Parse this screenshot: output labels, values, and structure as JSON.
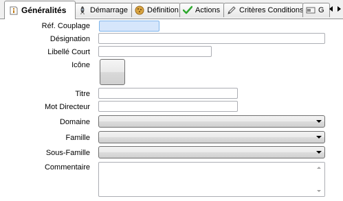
{
  "tabs": [
    {
      "label": "Généralités",
      "icon": "info-icon",
      "active": true
    },
    {
      "label": "Démarrage",
      "icon": "rocket-icon",
      "active": false
    },
    {
      "label": "Définition",
      "icon": "cookie-icon",
      "active": false
    },
    {
      "label": "Actions",
      "icon": "checkmark-icon",
      "active": false
    },
    {
      "label": "Critères Conditions",
      "icon": "pencil-icon",
      "active": false
    },
    {
      "label": "G",
      "icon": "card-icon",
      "active": false
    }
  ],
  "form": {
    "ref_couplage": {
      "label": "Réf. Couplage",
      "value": ""
    },
    "designation": {
      "label": "Désignation",
      "value": ""
    },
    "libelle_court": {
      "label": "Libellé Court",
      "value": ""
    },
    "icone": {
      "label": "Icône"
    },
    "titre": {
      "label": "Titre",
      "value": ""
    },
    "mot_directeur": {
      "label": "Mot Directeur",
      "value": ""
    },
    "domaine": {
      "label": "Domaine",
      "value": ""
    },
    "famille": {
      "label": "Famille",
      "value": ""
    },
    "sous_famille": {
      "label": "Sous-Famille",
      "value": ""
    },
    "commentaire": {
      "label": "Commentaire",
      "value": ""
    }
  },
  "colors": {
    "focus_bg": "#d6e6fb",
    "focus_border": "#7eb4ea"
  }
}
